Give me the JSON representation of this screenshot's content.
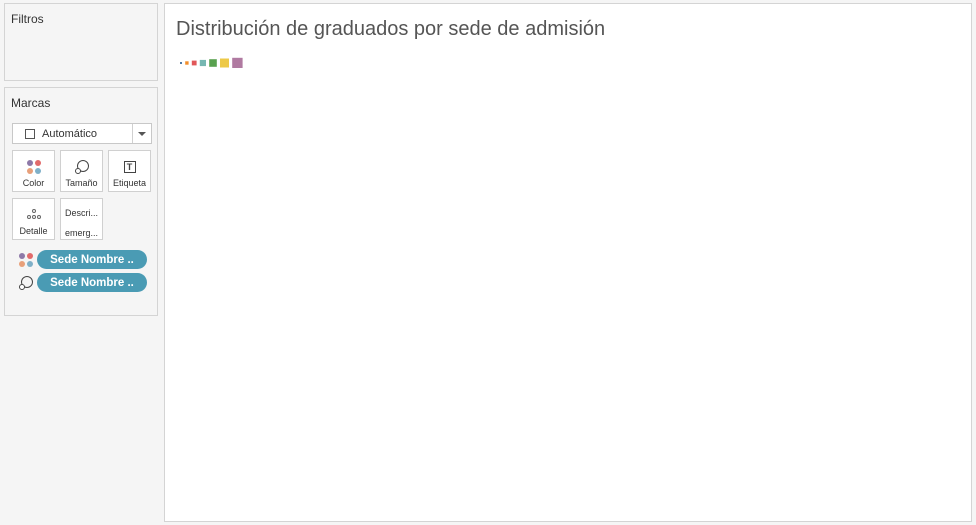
{
  "filters": {
    "title": "Filtros"
  },
  "marks": {
    "title": "Marcas",
    "mark_type": "Automático",
    "buttons": {
      "color": "Color",
      "size": "Tamaño",
      "label": "Etiqueta",
      "detail": "Detalle",
      "tooltip_line1": "Descri...",
      "tooltip_line2": "emerg..."
    },
    "pills": [
      {
        "field": "Sede Nombre ..",
        "encoding": "color"
      },
      {
        "field": "Sede Nombre ..",
        "encoding": "size"
      }
    ]
  },
  "view": {
    "title": "Distribución de graduados por sede de admisión",
    "legend_colors": [
      "#4e79a7",
      "#f28e2b",
      "#e15759",
      "#76b7b2",
      "#59a14f",
      "#edc948",
      "#b07aa1"
    ]
  },
  "colors": {
    "pill": "#4a9bb4",
    "panel_bg": "#f5f5f5",
    "view_bg": "#ffffff"
  }
}
